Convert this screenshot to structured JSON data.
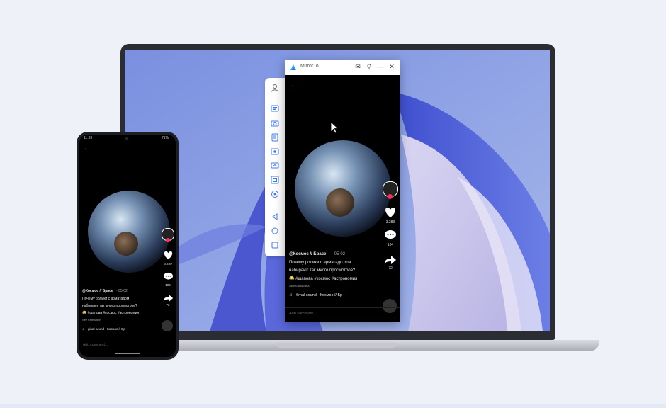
{
  "mirror_window": {
    "app_title": "MirrorTo",
    "back": "←",
    "author_handle": "@Космос // Брасе",
    "date": "· 05-02",
    "caption_line1": "Почему ролики с арматадо пом",
    "caption_line2": "набирают так много просмотров?",
    "hashtags": "😂 #шапова #космос #астрономия",
    "see_translation": "See translation",
    "music": "бrnal sound - Космос // Бр",
    "likes": "3.289",
    "comments": "104",
    "shares": "72",
    "comment_placeholder": "Add comment..."
  },
  "phone": {
    "status_time": "11:39",
    "status_battery": "71%",
    "back": "←",
    "author_handle": "@Космос // Брасе",
    "date": "· 05-02",
    "caption_line1": "Почему ролики с арматадом",
    "caption_line2": "набирают так много просмотров?",
    "hashtags": "😂 #шапова #космос #астрономия",
    "see_translation": "See translation",
    "music": "ginal sound - Космос // Бр",
    "likes": "3.289",
    "comments": "104",
    "shares": "72",
    "comment_placeholder": "Add comment..."
  },
  "toolbar": {
    "icons": [
      "user-icon",
      "screen-record-icon",
      "screenshot-icon",
      "keyboard-icon",
      "video-record-icon",
      "cast-icon",
      "fullscreen-icon",
      "location-icon",
      "back-nav-icon",
      "home-nav-icon",
      "recent-apps-icon"
    ]
  },
  "colors": {
    "accent": "#3f7cf0",
    "like_red": "#ff2c55",
    "wallpaper_blue": "#5b6fd6"
  }
}
